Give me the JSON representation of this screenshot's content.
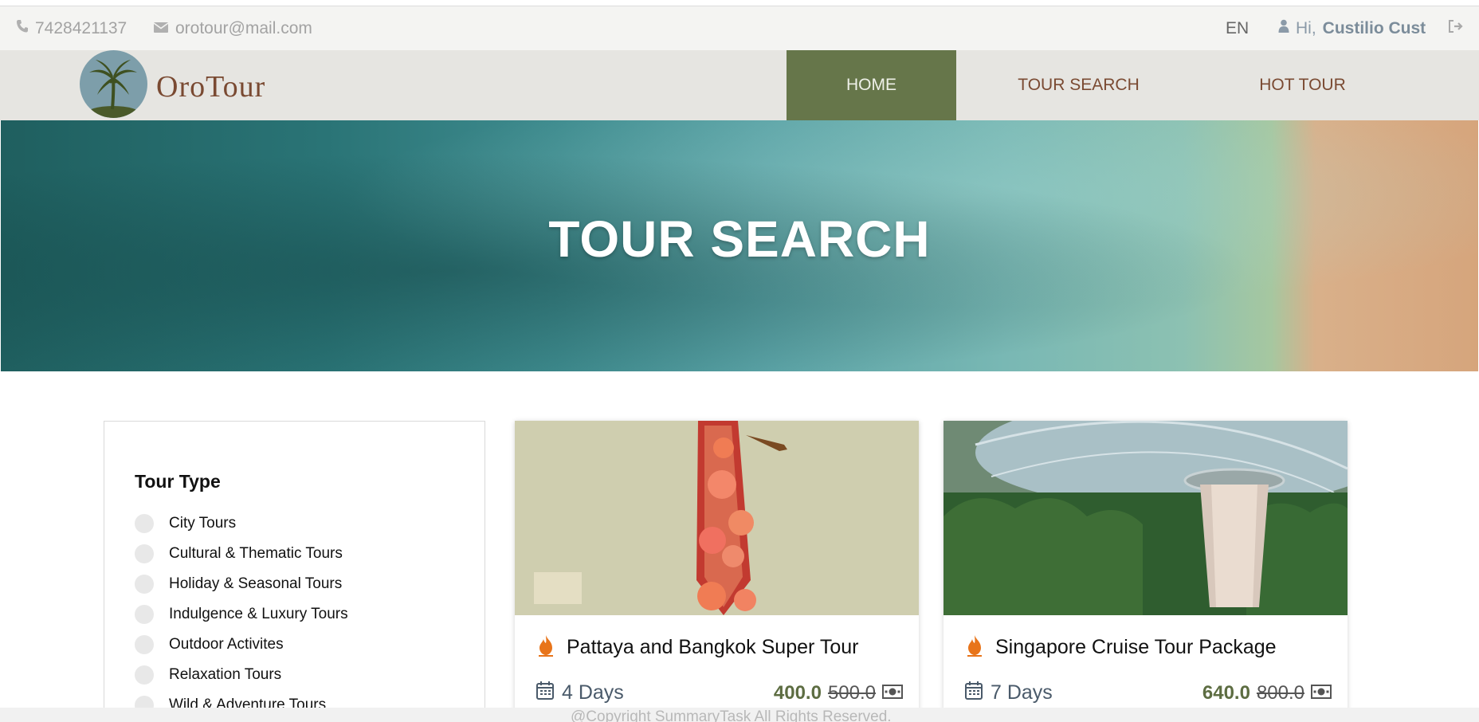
{
  "topbar": {
    "phone": "7428421137",
    "email": "orotour@mail.com",
    "language": "EN",
    "greeting_prefix": "Hi,",
    "user_name": "Custilio Cust"
  },
  "header": {
    "brand": "OroTour",
    "nav": [
      {
        "label": "HOME",
        "active": true
      },
      {
        "label": "TOUR SEARCH",
        "active": false
      },
      {
        "label": "HOT TOUR",
        "active": false
      }
    ]
  },
  "hero": {
    "title": "TOUR SEARCH"
  },
  "filter": {
    "heading": "Tour Type",
    "options": [
      "City Tours",
      "Cultural & Thematic Tours",
      "Holiday & Seasonal Tours",
      "Indulgence & Luxury Tours",
      "Outdoor Activites",
      "Relaxation Tours",
      "Wild & Adventure Tours"
    ]
  },
  "tours": [
    {
      "title": "Pattaya and Bangkok Super Tour",
      "duration": "4 Days",
      "price": "400.0",
      "old_price": "500.0"
    },
    {
      "title": "Singapore Cruise Tour Package",
      "duration": "7 Days",
      "price": "640.0",
      "old_price": "800.0"
    }
  ],
  "footer": {
    "copyright": "@Copyright SummaryTask All Rights Reserved."
  },
  "colors": {
    "nav_active": "#66764a",
    "brand": "#7a4a32",
    "price": "#5d6d42",
    "hot_icon": "#e8741a"
  },
  "icons": [
    "phone-icon",
    "envelope-icon",
    "user-icon",
    "logout-icon",
    "fire-icon",
    "calendar-icon",
    "money-icon"
  ]
}
